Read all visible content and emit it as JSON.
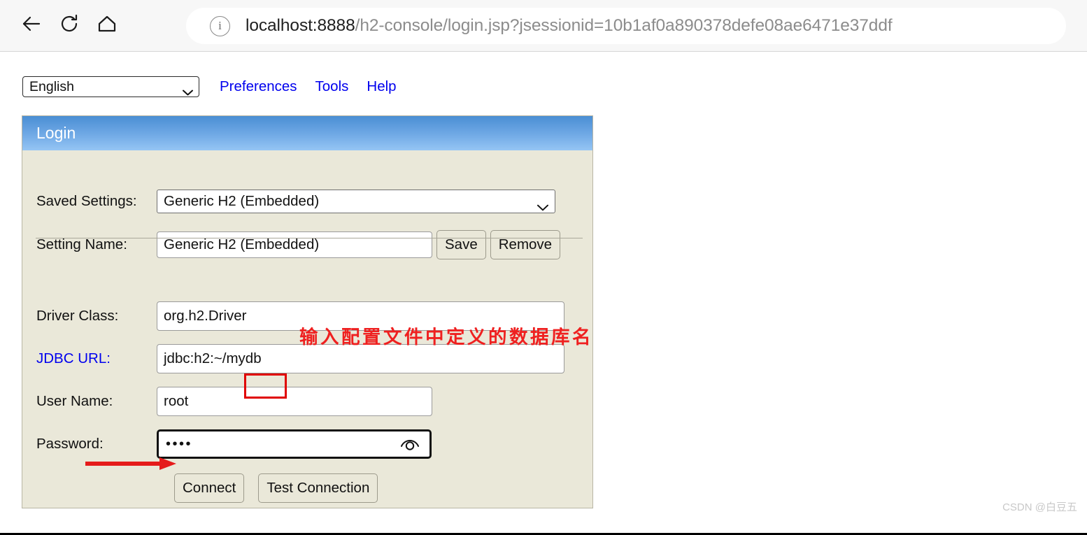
{
  "browser": {
    "back_icon": "back-arrow-icon",
    "reload_icon": "reload-icon",
    "home_icon": "home-icon",
    "info_icon": "info-circle-icon",
    "info_glyph": "i",
    "url_host": "localhost:8888",
    "url_path": "/h2-console/login.jsp?jsessionid=10b1af0a890378defe08ae6471e37ddf",
    "url_full": "localhost:8888/h2-console/login.jsp?jsessionid=10b1af0a890378defe08ae6471e37ddf"
  },
  "toolbar": {
    "language": "English",
    "language_options": [
      "English"
    ],
    "links": [
      {
        "label": "Preferences"
      },
      {
        "label": "Tools"
      },
      {
        "label": "Help"
      }
    ]
  },
  "panel": {
    "title": "Login",
    "header_color_top": "#4a8ed4",
    "header_color_bottom": "#95c5f4",
    "body_color": "#eae8d9",
    "fields": {
      "saved_settings_label": "Saved Settings:",
      "saved_settings_value": "Generic H2 (Embedded)",
      "saved_settings_options": [
        "Generic H2 (Embedded)"
      ],
      "setting_name_label": "Setting Name:",
      "setting_name_value": "Generic H2 (Embedded)",
      "save_label": "Save",
      "remove_label": "Remove",
      "driver_class_label": "Driver Class:",
      "driver_class_value": "org.h2.Driver",
      "jdbc_url_label": "JDBC URL:",
      "jdbc_url_value": "jdbc:h2:~/mydb",
      "user_name_label": "User Name:",
      "user_name_value": "root",
      "password_label": "Password:",
      "password_value": "••••",
      "password_reveal_icon": "eye-icon"
    },
    "buttons": {
      "connect_label": "Connect",
      "test_connection_label": "Test Connection"
    }
  },
  "annotations": {
    "note_text": "输入配置文件中定义的数据库名",
    "note_color": "#ef2020",
    "highlight_target": "mydb",
    "arrow_color": "#e51b1b",
    "arrow_points_to": "Connect"
  },
  "watermark": "CSDN @白豆五"
}
